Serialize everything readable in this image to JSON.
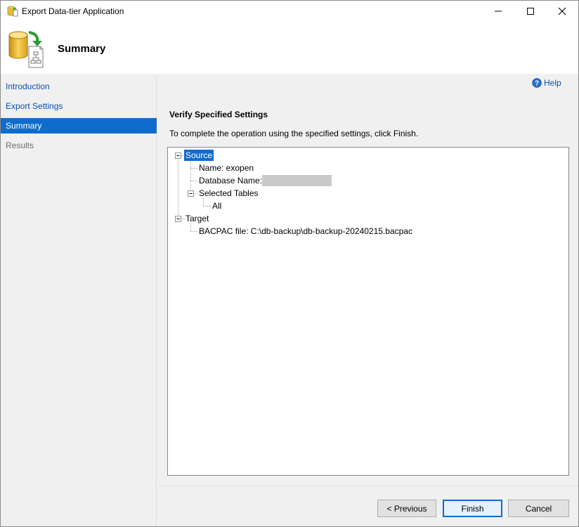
{
  "window": {
    "title": "Export Data-tier Application",
    "icon": "database-export-icon",
    "controls": [
      "minimize-icon",
      "maximize-icon",
      "close-icon"
    ]
  },
  "header": {
    "title": "Summary",
    "icon": "database-to-document-icon"
  },
  "sidebar": {
    "items": [
      {
        "label": "Introduction",
        "state": "link"
      },
      {
        "label": "Export Settings",
        "state": "link"
      },
      {
        "label": "Summary",
        "state": "selected"
      },
      {
        "label": "Results",
        "state": "disabled"
      }
    ]
  },
  "main": {
    "help_label": "Help",
    "section_title": "Verify Specified Settings",
    "instruction": "To complete the operation using the specified settings, click Finish.",
    "tree": {
      "source": "Source",
      "name": "Name: exopen",
      "database_name": "Database Name:",
      "selected_tables": "Selected Tables",
      "all": "All",
      "target": "Target",
      "bacpac": "BACPAC file: C:\\db-backup\\db-backup-20240215.bacpac"
    }
  },
  "footer": {
    "previous_label": "< Previous",
    "finish_label": "Finish",
    "cancel_label": "Cancel"
  },
  "colors": {
    "accent": "#0f6ccc",
    "link": "#0b4fb6"
  }
}
